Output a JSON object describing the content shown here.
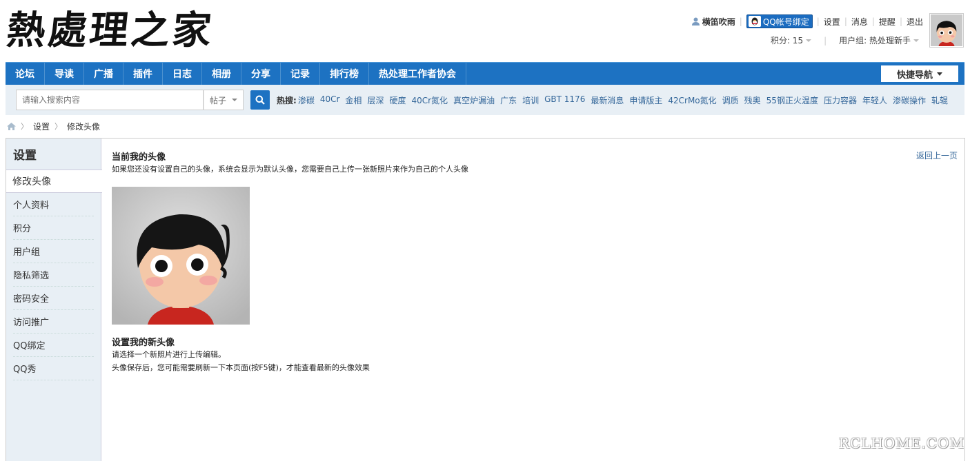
{
  "brand": {
    "logo_text": "熱處理之家"
  },
  "user": {
    "name": "横笛吹雨",
    "qq_bind": "QQ帐号绑定",
    "links": [
      "设置",
      "消息",
      "提醒",
      "退出"
    ],
    "points_label": "积分: 15",
    "group_label": "用户组: 热处理新手"
  },
  "nav": {
    "items": [
      "论坛",
      "导读",
      "广播",
      "插件",
      "日志",
      "相册",
      "分享",
      "记录",
      "排行榜",
      "热处理工作者协会"
    ],
    "quick_nav": "快捷导航"
  },
  "search": {
    "placeholder": "请输入搜索内容",
    "type": "帖子",
    "hot_label": "热搜:",
    "hot_terms": [
      "渗碳",
      "40Cr",
      "金相",
      "层深",
      "硬度",
      "40Cr氮化",
      "真空炉漏油",
      "广东",
      "培训",
      "GBT 1176",
      "最新消息",
      "申请版主",
      "42CrMo氮化",
      "调质",
      "残奥",
      "55钢正火温度",
      "压力容器",
      "年轻人",
      "渗碳操作",
      "轧辊"
    ]
  },
  "breadcrumb": {
    "items": [
      "设置",
      "修改头像"
    ]
  },
  "sidebar": {
    "title": "设置",
    "items": [
      "修改头像",
      "个人资料",
      "积分",
      "用户组",
      "隐私筛选",
      "密码安全",
      "访问推广",
      "QQ绑定",
      "QQ秀"
    ]
  },
  "main": {
    "current_title": "当前我的头像",
    "current_desc": "如果您还没有设置自己的头像，系统会显示为默认头像，您需要自己上传一张新照片来作为自己的个人头像",
    "back_link": "返回上一页",
    "new_title": "设置我的新头像",
    "new_desc1": "请选择一个新照片进行上传编辑。",
    "new_desc2": "头像保存后，您可能需要刷新一下本页面(按F5键)，才能查看最新的头像效果"
  },
  "watermark": "RCLHOME.COM",
  "colors": {
    "nav_blue": "#1d72c2",
    "link_blue": "#336699",
    "search_bg": "#e8eff5"
  }
}
